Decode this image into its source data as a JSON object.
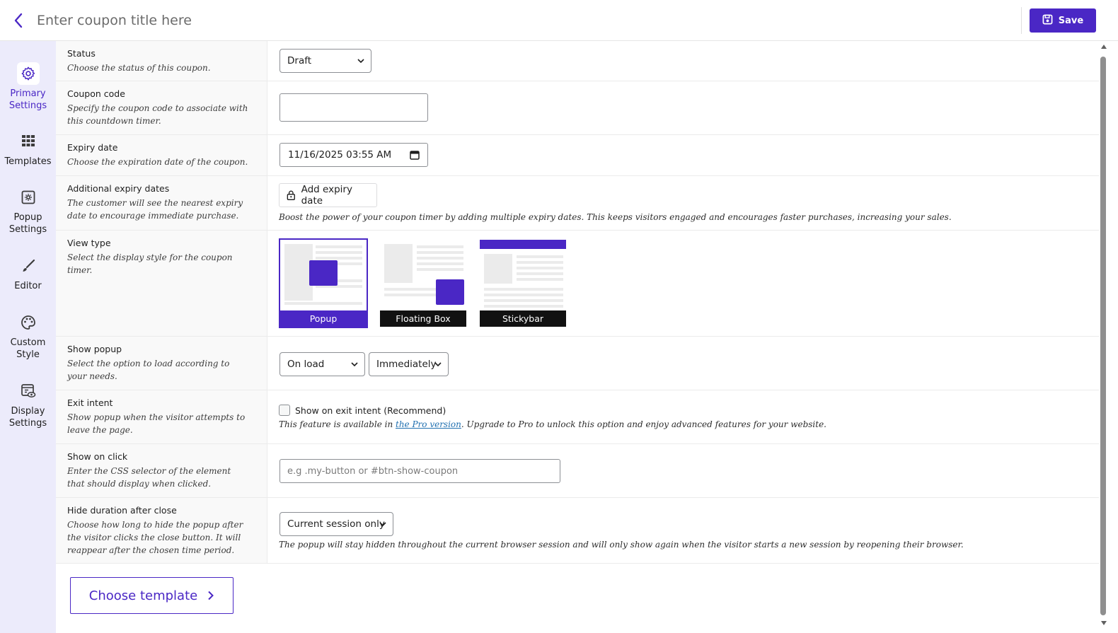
{
  "header": {
    "title_placeholder": "Enter coupon title here",
    "save_label": "Save",
    "accent_color": "#4a27c5"
  },
  "sidebar": {
    "items": [
      {
        "label": "Primary Settings",
        "icon": "gear-icon",
        "active": true
      },
      {
        "label": "Templates",
        "icon": "grid-icon",
        "active": false
      },
      {
        "label": "Popup Settings",
        "icon": "popup-gear-icon",
        "active": false
      },
      {
        "label": "Editor",
        "icon": "brush-icon",
        "active": false
      },
      {
        "label": "Custom Style",
        "icon": "palette-icon",
        "active": false
      },
      {
        "label": "Display Settings",
        "icon": "display-eye-icon",
        "active": false
      }
    ]
  },
  "rows": {
    "status": {
      "title": "Status",
      "desc": "Choose the status of this coupon.",
      "value": "Draft"
    },
    "coupon_code": {
      "title": "Coupon code",
      "desc": "Specify the coupon code to associate with this countdown timer.",
      "value": ""
    },
    "expiry": {
      "title": "Expiry date",
      "desc": "Choose the expiration date of the coupon.",
      "value": "11/16/2025 03:55 AM"
    },
    "additional_expiry": {
      "title": "Additional expiry dates",
      "desc": "The customer will see the nearest expiry date to encourage immediate purchase.",
      "button": "Add expiry date",
      "help": "Boost the power of your coupon timer by adding multiple expiry dates. This keeps visitors engaged and encourages faster purchases, increasing your sales."
    },
    "view_type": {
      "title": "View type",
      "desc": "Select the display style for the coupon timer.",
      "options": [
        "Popup",
        "Floating Box",
        "Stickybar"
      ],
      "selected": "Popup"
    },
    "show_popup": {
      "title": "Show popup",
      "desc": "Select the option to load according to your needs.",
      "trigger": "On load",
      "delay": "Immediately"
    },
    "exit_intent": {
      "title": "Exit intent",
      "desc": "Show popup when the visitor attempts to leave the page.",
      "checkbox_label": "Show on exit intent (Recommend)",
      "help_before": "This feature is available in ",
      "help_link": "the Pro version",
      "help_after": ". Upgrade to Pro to unlock this option and enjoy advanced features for your website."
    },
    "show_on_click": {
      "title": "Show on click",
      "desc": "Enter the CSS selector of the element that should display when clicked.",
      "placeholder": "e.g .my-button or #btn-show-coupon"
    },
    "hide_duration": {
      "title": "Hide duration after close",
      "desc": "Choose how long to hide the popup after the visitor clicks the close button. It will reappear after the chosen time period.",
      "value": "Current session only",
      "help": "The popup will stay hidden throughout the current browser session and will only show again when the visitor starts a new session by reopening their browser."
    }
  },
  "footer": {
    "choose_template_label": "Choose template"
  }
}
